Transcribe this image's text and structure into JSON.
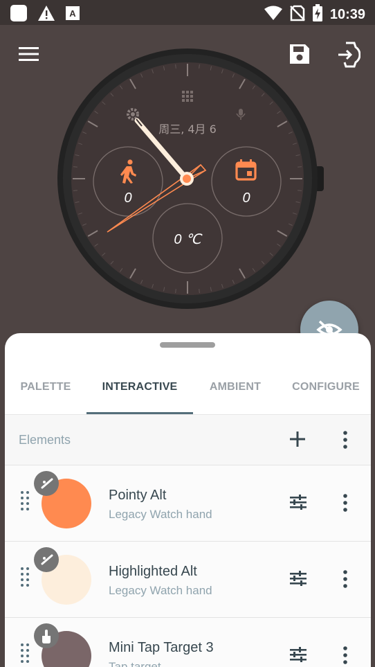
{
  "status_bar": {
    "time": "10:39",
    "left_icons": [
      "app-square-icon",
      "warning-icon",
      "translate-icon"
    ],
    "right_icons": [
      "wifi-icon",
      "no-sim-icon",
      "battery-charging-icon"
    ]
  },
  "toolbar": {
    "menu_icon": "hamburger-menu-icon",
    "save_icon": "save-icon",
    "export_icon": "watch-export-icon"
  },
  "watch_face": {
    "date_text": "周三, 4月 6",
    "steps_value": "0",
    "calendar_value": "0",
    "temperature_value": "0 ℃",
    "accent_color": "#ff8a50"
  },
  "fab": {
    "icon": "visibility-off-icon"
  },
  "tabs": [
    {
      "label": "PALETTE"
    },
    {
      "label": "INTERACTIVE"
    },
    {
      "label": "AMBIENT"
    },
    {
      "label": "CONFIGURE"
    }
  ],
  "elements_header": {
    "title": "Elements"
  },
  "elements": [
    {
      "title": "Pointy Alt",
      "subtitle": "Legacy Watch hand",
      "color": "#ff8a50",
      "badge_icon": "watch-hand-icon"
    },
    {
      "title": "Highlighted Alt",
      "subtitle": "Legacy Watch hand",
      "color": "#fdeedc",
      "badge_icon": "watch-hand-icon"
    },
    {
      "title": "Mini Tap Target 3",
      "subtitle": "Tap target",
      "color": "#7a6668",
      "badge_icon": "touch-icon"
    }
  ]
}
